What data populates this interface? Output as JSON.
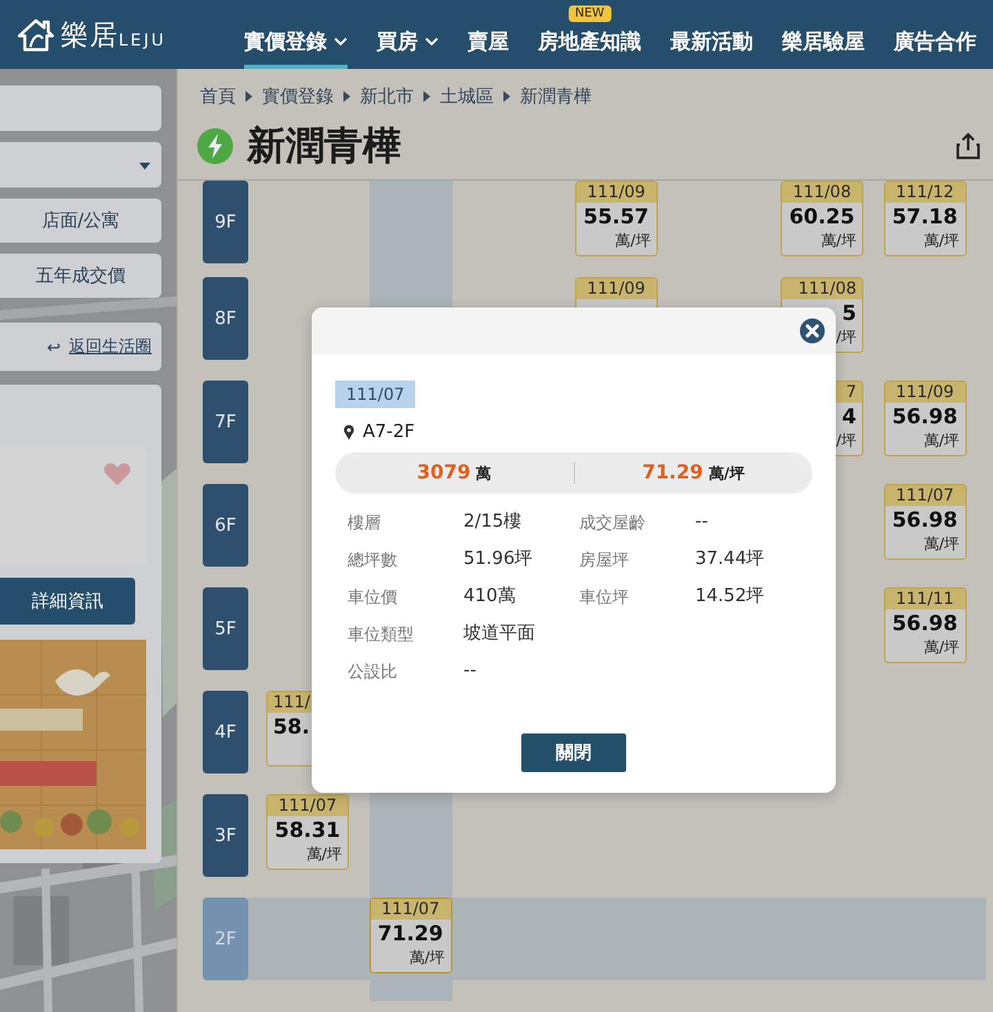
{
  "header": {
    "logo": "樂居",
    "logo_sub": "LEJU",
    "nav": [
      {
        "label": "實價登錄",
        "selected": true,
        "dropdown": true
      },
      {
        "label": "買房",
        "selected": false,
        "dropdown": true
      },
      {
        "label": "賣屋",
        "selected": false,
        "dropdown": false
      },
      {
        "label": "房地產知識",
        "selected": false,
        "dropdown": false,
        "badge": "NEW"
      },
      {
        "label": "最新活動",
        "selected": false,
        "dropdown": false
      },
      {
        "label": "樂居驗屋",
        "selected": false,
        "dropdown": false
      },
      {
        "label": "廣告合作",
        "selected": false,
        "dropdown": false
      }
    ]
  },
  "sidebar": {
    "buttons": [
      "店面/公寓",
      "五年成交價"
    ],
    "back_link": {
      "icon": "↩",
      "label": "返回生活圈"
    },
    "detail_button": "詳細資訊"
  },
  "breadcrumb": [
    "首頁",
    "實價登錄",
    "新北市",
    "土城區",
    "新潤青樺"
  ],
  "title": "新潤青樺",
  "floors": [
    {
      "label": "9F",
      "selected": false,
      "units": [
        {
          "kind": "empty"
        },
        {
          "kind": "empty"
        },
        {
          "kind": "empty"
        },
        {
          "kind": "deal",
          "selected": false,
          "date": "111/09",
          "price": "55.57",
          "unit": "萬/坪"
        },
        {
          "kind": "empty"
        },
        {
          "kind": "deal",
          "selected": false,
          "date": "111/08",
          "price": "60.25",
          "unit": "萬/坪"
        },
        {
          "kind": "deal",
          "selected": false,
          "date": "111/12",
          "price": "57.18",
          "unit": "萬/坪"
        }
      ]
    },
    {
      "label": "8F",
      "selected": false,
      "units": [
        {
          "kind": "empty"
        },
        {
          "kind": "empty"
        },
        {
          "kind": "empty"
        },
        {
          "kind": "deal",
          "selected": false,
          "date": "111/09"
        },
        {
          "kind": "empty"
        },
        {
          "kind": "tail",
          "selected": false,
          "date": "111/08",
          "price": "5",
          "unit": "/坪"
        },
        {
          "kind": "empty"
        }
      ]
    },
    {
      "label": "7F",
      "selected": false,
      "units": [
        {
          "kind": "empty"
        },
        {
          "kind": "empty"
        },
        {
          "kind": "empty"
        },
        {
          "kind": "empty"
        },
        {
          "kind": "empty"
        },
        {
          "kind": "tail",
          "selected": false,
          "date": "7",
          "price": "4",
          "unit": "/坪"
        },
        {
          "kind": "deal",
          "selected": false,
          "date": "111/09",
          "price": "56.98",
          "unit": "萬/坪"
        }
      ]
    },
    {
      "label": "6F",
      "selected": false,
      "units": [
        {
          "kind": "empty"
        },
        {
          "kind": "empty"
        },
        {
          "kind": "empty"
        },
        {
          "kind": "empty"
        },
        {
          "kind": "empty"
        },
        {
          "kind": "empty"
        },
        {
          "kind": "deal",
          "selected": false,
          "date": "111/07",
          "price": "56.98",
          "unit": "萬/坪"
        }
      ]
    },
    {
      "label": "5F",
      "selected": false,
      "units": [
        {
          "kind": "empty"
        },
        {
          "kind": "empty"
        },
        {
          "kind": "empty"
        },
        {
          "kind": "empty"
        },
        {
          "kind": "empty"
        },
        {
          "kind": "empty"
        },
        {
          "kind": "deal",
          "selected": false,
          "date": "111/11",
          "price": "56.98",
          "unit": "萬/坪"
        }
      ]
    },
    {
      "label": "4F",
      "selected": false,
      "units": [
        {
          "kind": "head",
          "selected": false,
          "date": "111/",
          "price": "58."
        },
        {
          "kind": "empty"
        },
        {
          "kind": "empty"
        },
        {
          "kind": "empty"
        },
        {
          "kind": "empty"
        },
        {
          "kind": "empty"
        },
        {
          "kind": "empty"
        }
      ]
    },
    {
      "label": "3F",
      "selected": false,
      "units": [
        {
          "kind": "deal",
          "selected": false,
          "date": "111/07",
          "price": "58.31",
          "unit": "萬/坪"
        },
        {
          "kind": "empty"
        },
        {
          "kind": "empty"
        },
        {
          "kind": "empty"
        },
        {
          "kind": "empty"
        },
        {
          "kind": "empty"
        },
        {
          "kind": "empty"
        }
      ]
    },
    {
      "label": "2F",
      "selected": true,
      "units": [
        {
          "kind": "empty"
        },
        {
          "kind": "deal",
          "selected": true,
          "date": "111/07",
          "price": "71.29",
          "unit": "萬/坪"
        },
        {
          "kind": "empty"
        },
        {
          "kind": "empty"
        },
        {
          "kind": "empty"
        },
        {
          "kind": "empty"
        },
        {
          "kind": "empty"
        }
      ]
    }
  ],
  "modal": {
    "date": "111/07",
    "location": "A7-2F",
    "price": {
      "value": "3079",
      "unit": "萬"
    },
    "unit_price": {
      "value": "71.29",
      "unit": "萬/坪"
    },
    "detail_rows": [
      [
        {
          "label": "樓層",
          "value": "2/15樓"
        },
        {
          "label": "成交屋齡",
          "value": "--"
        }
      ],
      [
        {
          "label": "總坪數",
          "value": "51.96坪"
        },
        {
          "label": "房屋坪",
          "value": "37.44坪"
        }
      ],
      [
        {
          "label": "車位價",
          "value": "410萬"
        },
        {
          "label": "車位坪",
          "value": "14.52坪"
        }
      ],
      [
        {
          "label": "車位類型",
          "value": "坡道平面"
        }
      ],
      [
        {
          "label": "公設比",
          "value": "--"
        }
      ]
    ],
    "close_button": "關閉"
  }
}
